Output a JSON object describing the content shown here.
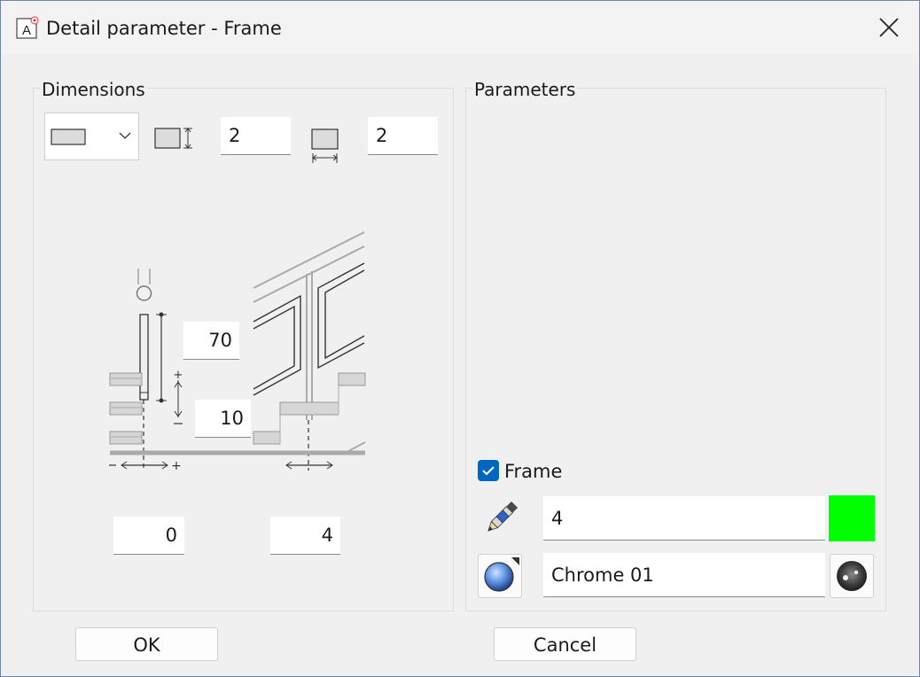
{
  "window": {
    "title": "Detail parameter - Frame"
  },
  "dimensions": {
    "label": "Dimensions",
    "height_value": "2",
    "width_value": "2",
    "post_height": "70",
    "bottom_offset": "10",
    "left_offset": "0",
    "right_offset": "4"
  },
  "parameters": {
    "label": "Parameters",
    "frame_checked": true,
    "frame_label": "Frame",
    "pen_value": "4",
    "material_value": "Chrome 01",
    "frame_color": "#00ff00"
  },
  "buttons": {
    "ok": "OK",
    "cancel": "Cancel"
  }
}
